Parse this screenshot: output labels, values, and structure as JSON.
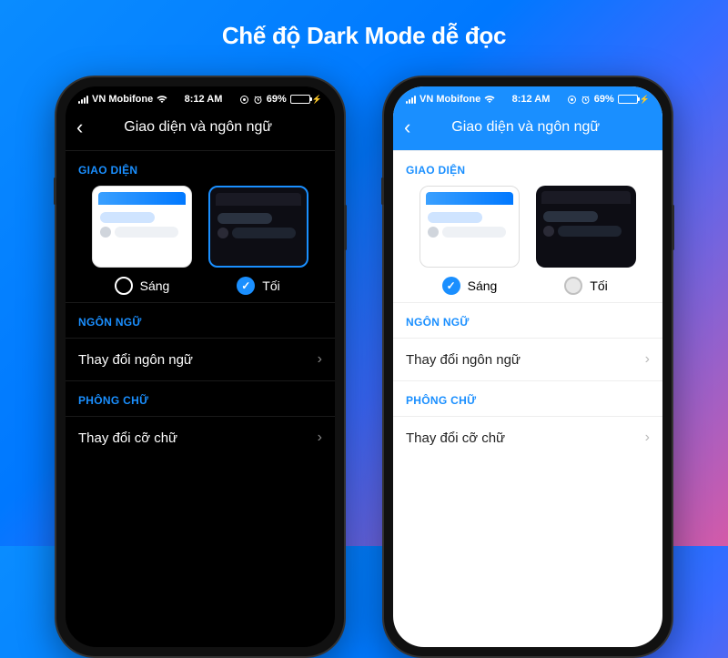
{
  "headline": "Chế độ Dark Mode dễ đọc",
  "status": {
    "carrier": "VN Mobifone",
    "time": "8:12 AM",
    "battery_pct": "69%"
  },
  "nav": {
    "title": "Giao diện và ngôn ngữ"
  },
  "sections": {
    "appearance": "GIAO DIỆN",
    "language": "NGÔN NGỮ",
    "font": "PHÔNG CHỮ"
  },
  "themes": {
    "light_label": "Sáng",
    "dark_label": "Tối"
  },
  "menu": {
    "change_language": "Thay đổi ngôn ngữ",
    "change_font_size": "Thay đổi cỡ chữ"
  }
}
